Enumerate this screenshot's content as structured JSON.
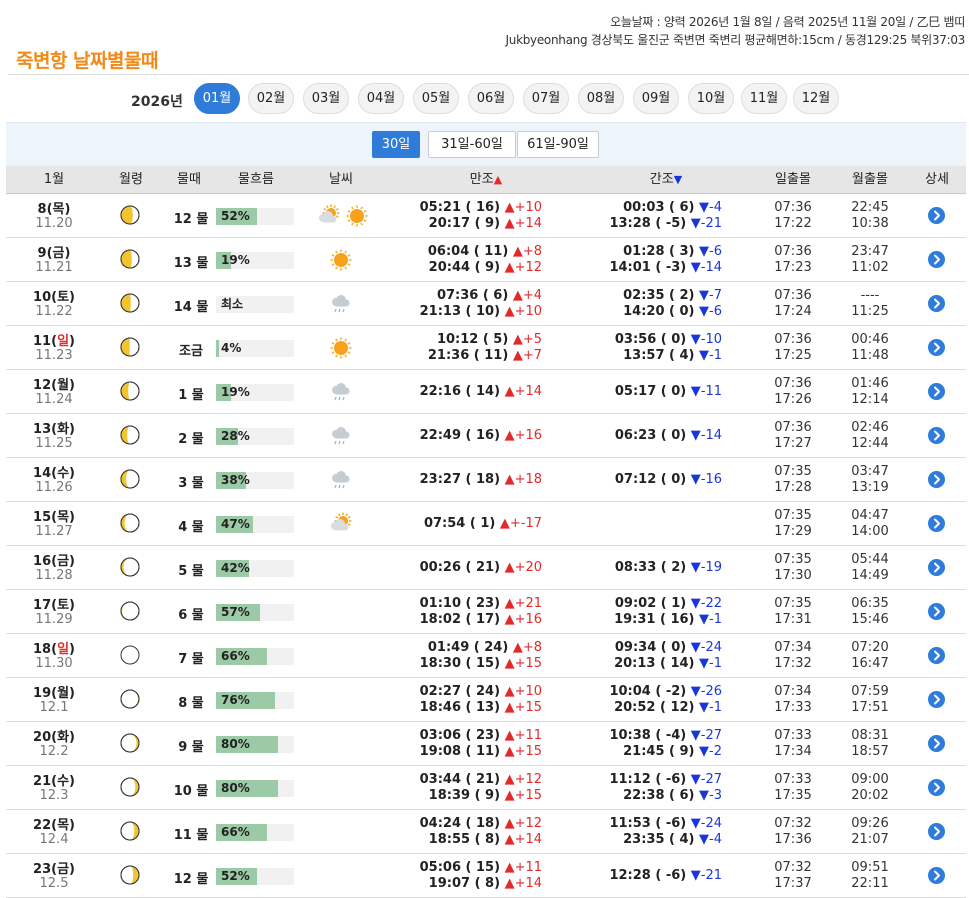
{
  "header": {
    "title": "죽변항 날짜별물때",
    "today_line": "오늘날짜 : 양력 2026년 1월 8일 / 음력 2025년 11월 20일 / 乙巳 뱀띠",
    "location_line": "Jukbyeonhang 경상북도 울진군 죽변면 죽변리 평균해면하:15cm / 동경129:25 북위37:03"
  },
  "months": {
    "year": "2026년",
    "items": [
      "01월",
      "02월",
      "03월",
      "04월",
      "05월",
      "06월",
      "07월",
      "08월",
      "09월",
      "10월",
      "11월",
      "12월"
    ],
    "active_index": 0
  },
  "ranges": {
    "items": [
      "30일",
      "31일-60일",
      "61일-90일"
    ],
    "active_index": 0
  },
  "columns": {
    "month": "1월",
    "moon_age": "월령",
    "mul": "물때",
    "flow": "물흐름",
    "weather": "날씨",
    "high": "만조",
    "low": "간조",
    "sun": "일출몰",
    "moon": "월출몰",
    "detail": "상세"
  },
  "rows": [
    {
      "date": "8(목)",
      "weekday_red": false,
      "lunar": "11.20",
      "phase": 0.67,
      "mul": "12 물",
      "flow": "52%",
      "flow_value": 0.52,
      "weather": [
        "partly-cloudy-icon",
        "sun-icon"
      ],
      "high": [
        {
          "t": "05:21 ( 16)",
          "d": "+10"
        },
        {
          "t": "20:17 (  9)",
          "d": "+14"
        }
      ],
      "low": [
        {
          "t": "00:03 (  6)",
          "d": "-4"
        },
        {
          "t": "13:28 ( -5)",
          "d": "-21"
        }
      ],
      "sun": [
        "07:36",
        "17:22"
      ],
      "moon": [
        "22:45",
        "10:38"
      ]
    },
    {
      "date": "9(금)",
      "weekday_red": false,
      "lunar": "11.21",
      "phase": 0.7,
      "mul": "13 물",
      "flow": "19%",
      "flow_value": 0.19,
      "weather": [
        "sun-icon"
      ],
      "high": [
        {
          "t": "06:04 ( 11)",
          "d": "+8"
        },
        {
          "t": "20:44 (  9)",
          "d": "+12"
        }
      ],
      "low": [
        {
          "t": "01:28 (  3)",
          "d": "-6"
        },
        {
          "t": "14:01 ( -3)",
          "d": "-14"
        }
      ],
      "sun": [
        "07:36",
        "17:23"
      ],
      "moon": [
        "23:47",
        "11:02"
      ]
    },
    {
      "date": "10(토)",
      "weekday_red": false,
      "lunar": "11.22",
      "phase": 0.73,
      "mul": "14 물",
      "flow": "최소",
      "flow_value": 0,
      "weather": [
        "rain-icon"
      ],
      "high": [
        {
          "t": "07:36 (  6)",
          "d": "+4"
        },
        {
          "t": "21:13 ( 10)",
          "d": "+10"
        }
      ],
      "low": [
        {
          "t": "02:35 (  2)",
          "d": "-7"
        },
        {
          "t": "14:20 (  0)",
          "d": "-6"
        }
      ],
      "sun": [
        "07:36",
        "17:24"
      ],
      "moon": [
        "----",
        "11:25"
      ]
    },
    {
      "date": "11(일)",
      "weekday_red": true,
      "lunar": "11.23",
      "phase": 0.76,
      "mul": "조금",
      "flow": "4%",
      "flow_value": 0.04,
      "weather": [
        "sun-icon"
      ],
      "high": [
        {
          "t": "10:12 (  5)",
          "d": "+5"
        },
        {
          "t": "21:36 ( 11)",
          "d": "+7"
        }
      ],
      "low": [
        {
          "t": "03:56 (  0)",
          "d": "-10"
        },
        {
          "t": "13:57 (  4)",
          "d": "-1"
        }
      ],
      "sun": [
        "07:36",
        "17:25"
      ],
      "moon": [
        "00:46",
        "11:48"
      ]
    },
    {
      "date": "12(월)",
      "weekday_red": false,
      "lunar": "11.24",
      "phase": 0.8,
      "mul": "1 물",
      "flow": "19%",
      "flow_value": 0.19,
      "weather": [
        "rain-icon"
      ],
      "high": [
        {
          "t": "22:16 ( 14)",
          "d": "+14"
        }
      ],
      "low": [
        {
          "t": "05:17 (  0)",
          "d": "-11"
        }
      ],
      "sun": [
        "07:36",
        "17:26"
      ],
      "moon": [
        "01:46",
        "12:14"
      ]
    },
    {
      "date": "13(화)",
      "weekday_red": false,
      "lunar": "11.25",
      "phase": 0.83,
      "mul": "2 물",
      "flow": "28%",
      "flow_value": 0.28,
      "weather": [
        "rain-icon"
      ],
      "high": [
        {
          "t": "22:49 ( 16)",
          "d": "+16"
        }
      ],
      "low": [
        {
          "t": "06:23 (  0)",
          "d": "-14"
        }
      ],
      "sun": [
        "07:36",
        "17:27"
      ],
      "moon": [
        "02:46",
        "12:44"
      ]
    },
    {
      "date": "14(수)",
      "weekday_red": false,
      "lunar": "11.26",
      "phase": 0.86,
      "mul": "3 물",
      "flow": "38%",
      "flow_value": 0.38,
      "weather": [
        "rain-icon"
      ],
      "high": [
        {
          "t": "23:27 ( 18)",
          "d": "+18"
        }
      ],
      "low": [
        {
          "t": "07:12 (  0)",
          "d": "-16"
        }
      ],
      "sun": [
        "07:35",
        "17:28"
      ],
      "moon": [
        "03:47",
        "13:19"
      ]
    },
    {
      "date": "15(목)",
      "weekday_red": false,
      "lunar": "11.27",
      "phase": 0.9,
      "mul": "4 물",
      "flow": "47%",
      "flow_value": 0.47,
      "weather": [
        "partly-cloudy-icon"
      ],
      "high": [
        {
          "t": "07:54 (  1)",
          "d": "+-17"
        }
      ],
      "low": [],
      "sun": [
        "07:35",
        "17:29"
      ],
      "moon": [
        "04:47",
        "14:00"
      ]
    },
    {
      "date": "16(금)",
      "weekday_red": false,
      "lunar": "11.28",
      "phase": 0.93,
      "mul": "5 물",
      "flow": "42%",
      "flow_value": 0.42,
      "weather": [],
      "high": [
        {
          "t": "00:26 ( 21)",
          "d": "+20"
        }
      ],
      "low": [
        {
          "t": "08:33 (  2)",
          "d": "-19"
        }
      ],
      "sun": [
        "07:35",
        "17:30"
      ],
      "moon": [
        "05:44",
        "14:49"
      ]
    },
    {
      "date": "17(토)",
      "weekday_red": false,
      "lunar": "11.29",
      "phase": 0.97,
      "mul": "6 물",
      "flow": "57%",
      "flow_value": 0.57,
      "weather": [],
      "high": [
        {
          "t": "01:10 ( 23)",
          "d": "+21"
        },
        {
          "t": "18:02 ( 17)",
          "d": "+16"
        }
      ],
      "low": [
        {
          "t": "09:02 (  1)",
          "d": "-22"
        },
        {
          "t": "19:31 ( 16)",
          "d": "-1"
        }
      ],
      "sun": [
        "07:35",
        "17:31"
      ],
      "moon": [
        "06:35",
        "15:46"
      ]
    },
    {
      "date": "18(일)",
      "weekday_red": true,
      "lunar": "11.30",
      "phase": 0,
      "mul": "7 물",
      "flow": "66%",
      "flow_value": 0.66,
      "weather": [],
      "high": [
        {
          "t": "01:49 ( 24)",
          "d": "+8"
        },
        {
          "t": "18:30 ( 15)",
          "d": "+15"
        }
      ],
      "low": [
        {
          "t": "09:34 (  0)",
          "d": "-24"
        },
        {
          "t": "20:13 ( 14)",
          "d": "-1"
        }
      ],
      "sun": [
        "07:34",
        "17:32"
      ],
      "moon": [
        "07:20",
        "16:47"
      ]
    },
    {
      "date": "19(월)",
      "weekday_red": false,
      "lunar": "12.1",
      "phase": 0.03,
      "mul": "8 물",
      "flow": "76%",
      "flow_value": 0.76,
      "weather": [],
      "high": [
        {
          "t": "02:27 ( 24)",
          "d": "+10"
        },
        {
          "t": "18:46 ( 13)",
          "d": "+15"
        }
      ],
      "low": [
        {
          "t": "10:04 ( -2)",
          "d": "-26"
        },
        {
          "t": "20:52 ( 12)",
          "d": "-1"
        }
      ],
      "sun": [
        "07:34",
        "17:33"
      ],
      "moon": [
        "07:59",
        "17:51"
      ]
    },
    {
      "date": "20(화)",
      "weekday_red": false,
      "lunar": "12.2",
      "phase": 0.07,
      "mul": "9 물",
      "flow": "80%",
      "flow_value": 0.8,
      "weather": [],
      "high": [
        {
          "t": "03:06 ( 23)",
          "d": "+11"
        },
        {
          "t": "19:08 ( 11)",
          "d": "+15"
        }
      ],
      "low": [
        {
          "t": "10:38 ( -4)",
          "d": "-27"
        },
        {
          "t": "21:45 (  9)",
          "d": "-2"
        }
      ],
      "sun": [
        "07:33",
        "17:34"
      ],
      "moon": [
        "08:31",
        "18:57"
      ]
    },
    {
      "date": "21(수)",
      "weekday_red": false,
      "lunar": "12.3",
      "phase": 0.1,
      "mul": "10 물",
      "flow": "80%",
      "flow_value": 0.8,
      "weather": [],
      "high": [
        {
          "t": "03:44 ( 21)",
          "d": "+12"
        },
        {
          "t": "18:39 (  9)",
          "d": "+15"
        }
      ],
      "low": [
        {
          "t": "11:12 ( -6)",
          "d": "-27"
        },
        {
          "t": "22:38 (  6)",
          "d": "-3"
        }
      ],
      "sun": [
        "07:33",
        "17:35"
      ],
      "moon": [
        "09:00",
        "20:02"
      ]
    },
    {
      "date": "22(목)",
      "weekday_red": false,
      "lunar": "12.4",
      "phase": 0.13,
      "mul": "11 물",
      "flow": "66%",
      "flow_value": 0.66,
      "weather": [],
      "high": [
        {
          "t": "04:24 ( 18)",
          "d": "+12"
        },
        {
          "t": "18:55 (  8)",
          "d": "+14"
        }
      ],
      "low": [
        {
          "t": "11:53 ( -6)",
          "d": "-24"
        },
        {
          "t": "23:35 (  4)",
          "d": "-4"
        }
      ],
      "sun": [
        "07:32",
        "17:36"
      ],
      "moon": [
        "09:26",
        "21:07"
      ]
    },
    {
      "date": "23(금)",
      "weekday_red": false,
      "lunar": "12.5",
      "phase": 0.16,
      "mul": "12 물",
      "flow": "52%",
      "flow_value": 0.52,
      "weather": [],
      "high": [
        {
          "t": "05:06 ( 15)",
          "d": "+11"
        },
        {
          "t": "19:07 (  8)",
          "d": "+14"
        }
      ],
      "low": [
        {
          "t": "12:28 ( -6)",
          "d": "-21"
        }
      ],
      "sun": [
        "07:32",
        "17:37"
      ],
      "moon": [
        "09:51",
        "22:11"
      ]
    }
  ],
  "colors": {
    "title": "#f08a19",
    "accent": "#2f7bd9",
    "flow_bar": "#9ccaa7",
    "up": "#e12b2b",
    "down": "#1a37d6"
  }
}
